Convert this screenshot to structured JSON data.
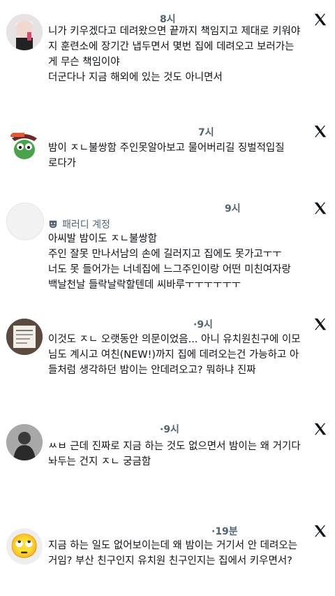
{
  "posts": [
    {
      "time": "8시",
      "lines": [
        "니가 키우겠다고 데려왔으면 끝까지 책임지고 제대로 키워야",
        "지 훈련소에 장기간 냅두면서 몇번 집에 데려오고 보러가는",
        "게 무슨 책임이야",
        "더군다나 지금 해외에 있는 것도 아니면서"
      ]
    },
    {
      "time": "7시",
      "lines": [
        "밤이 ㅈㄴ불쌍함   주인못알아보고 물어버리길  징벌적입질",
        "로다가"
      ]
    },
    {
      "time": "9시",
      "parody": "패러디 계정",
      "lines": [
        "아씨발 밤이도 ㅈㄴ불쌍함",
        "주인 잘못 만나서남의 손에 길러지고 집에도 못가고ㅜㅜ",
        "너도 못 들어가는 너네집에 느그주인이랑 어떤 미친여자랑",
        "백날천날 들락날락할텐데 씨바루ㅜㅜㅜㅜㅜㅜ"
      ]
    },
    {
      "time": "·9시",
      "lines": [
        "이것도 ㅈㄴ 오랫동안 의문이었음... 아니 유치원친구에 이모",
        "님도 계시고 여친(NEW!)까지 집에 데려오는건 가능하고 아",
        "들처럼 생각하던 밤이는 안데려오고? 뭐하냐 진짜"
      ]
    },
    {
      "time": "·9시",
      "lines": [
        "ㅆㅂ 근데 진짜로 지금 하는 것도 없으면서 밤이는 왜 거기다",
        "놔두는 건지 ㅈㄴ 궁금함"
      ]
    },
    {
      "time": "·19분",
      "avatar_emoji": "🙄",
      "lines": [
        "지금 하는 일도 없어보이는데 왜 밤이는 거기서 안 데려오는",
        "거임? 부산 친구인지 유치원 친구인지는 집에서 키우면서?"
      ]
    }
  ]
}
